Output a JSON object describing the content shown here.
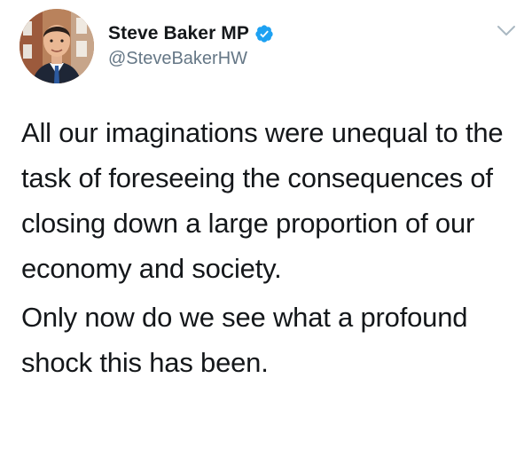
{
  "author": {
    "display_name": "Steve Baker MP",
    "handle": "@SteveBakerHW",
    "verified": true,
    "avatar_icon": "profile-photo"
  },
  "menu": {
    "icon": "chevron-down-icon"
  },
  "tweet": {
    "paragraphs": [
      "All our imaginations were unequal to the task of foreseeing the consequences of closing down a large proportion of our economy and society.",
      "Only now do we see what a profound shock this has been."
    ]
  },
  "colors": {
    "text": "#14171a",
    "secondary": "#657786",
    "verified_blue": "#1da1f2"
  }
}
